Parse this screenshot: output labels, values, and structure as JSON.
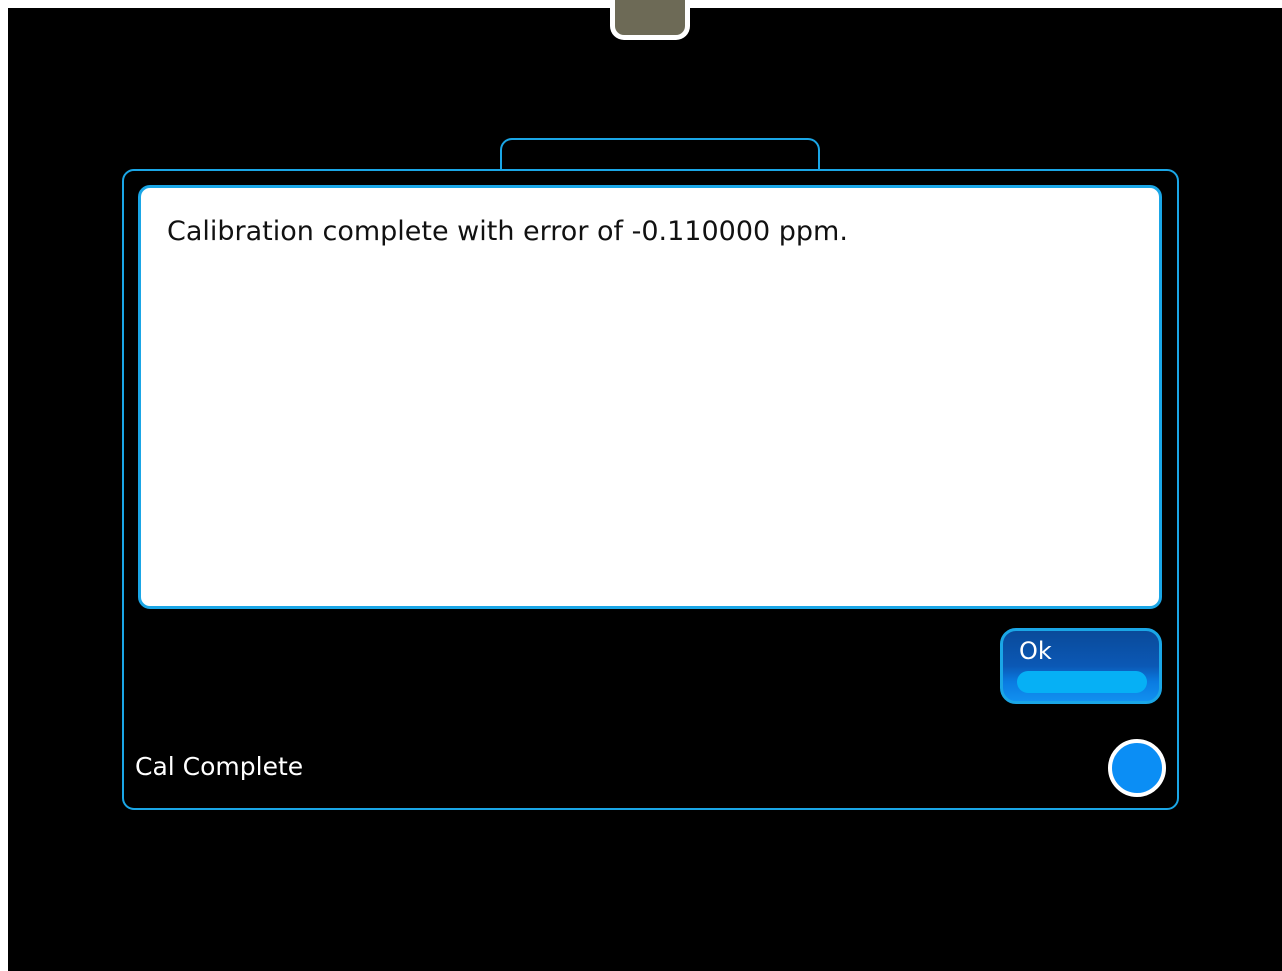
{
  "dialog": {
    "message": "Calibration complete with error of -0.110000 ppm.",
    "ok_label": "Ok",
    "status_text": "Cal Complete"
  },
  "colors": {
    "background": "#000000",
    "accent_border": "#1aa6e6",
    "status_indicator": "#0b8ef5"
  },
  "icons": {
    "top_handle": "drawer-handle-icon",
    "status_indicator": "status-dot-icon"
  }
}
